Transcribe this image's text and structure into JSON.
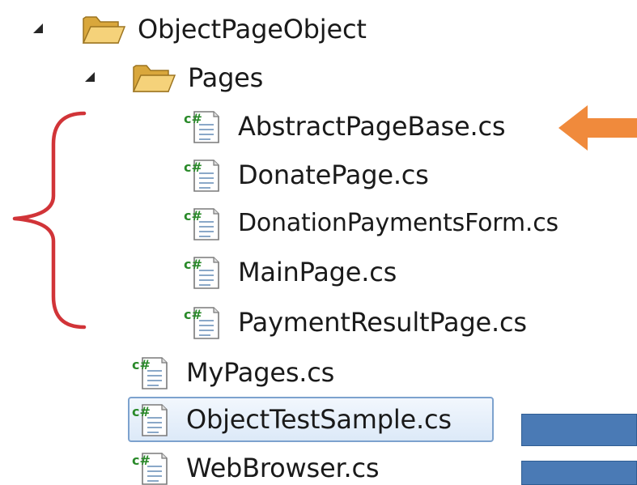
{
  "tree": {
    "root": {
      "label": "ObjectPageObject",
      "icon": "folder-open-icon",
      "expanded": true,
      "children": {
        "pages_folder": {
          "label": "Pages",
          "icon": "folder-open-icon",
          "expanded": true,
          "files": [
            {
              "label": "AbstractPageBase.cs",
              "icon": "csharp-file-icon"
            },
            {
              "label": "DonatePage.cs",
              "icon": "csharp-file-icon"
            },
            {
              "label": "DonationPaymentsForm.cs",
              "icon": "csharp-file-icon"
            },
            {
              "label": "MainPage.cs",
              "icon": "csharp-file-icon"
            },
            {
              "label": "PaymentResultPage.cs",
              "icon": "csharp-file-icon"
            }
          ]
        },
        "files": [
          {
            "label": "MyPages.cs",
            "icon": "csharp-file-icon",
            "selected": false
          },
          {
            "label": "ObjectTestSample.cs",
            "icon": "csharp-file-icon",
            "selected": true
          },
          {
            "label": "WebBrowser.cs",
            "icon": "csharp-file-icon",
            "selected": false
          }
        ]
      }
    }
  },
  "colors": {
    "brace": "#d13438",
    "arrow": "#f08a3c",
    "selection_border": "#7da2ce",
    "bar": "#4a7ab5",
    "folder": "#e8b84a",
    "csharp_green": "#2a8a2a"
  }
}
